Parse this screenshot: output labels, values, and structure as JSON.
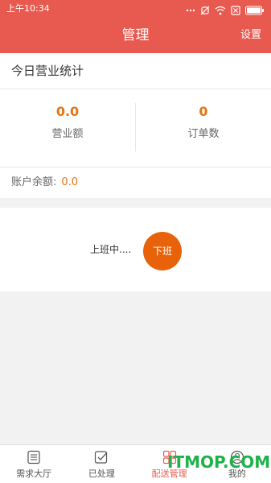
{
  "status": {
    "time": "上午10:34"
  },
  "header": {
    "title": "管理",
    "settings": "设置"
  },
  "stats": {
    "title": "今日营业统计",
    "revenue_value": "0.0",
    "revenue_label": "营业额",
    "orders_value": "0",
    "orders_label": "订单数",
    "balance_label": "账户余额:",
    "balance_value": "0.0"
  },
  "work": {
    "status": "上班中....",
    "button": "下班"
  },
  "tabs": [
    {
      "label": "需求大厅",
      "icon": "list-icon"
    },
    {
      "label": "已处理",
      "icon": "check-box-icon"
    },
    {
      "label": "配送管理",
      "icon": "grid-icon",
      "active": true
    },
    {
      "label": "我的",
      "icon": "user-icon"
    }
  ],
  "watermark": "ITMOP.COM",
  "colors": {
    "accent": "#e85a50",
    "value_orange": "#e8730f",
    "button_orange": "#e8620a",
    "watermark_green": "#1db24a"
  }
}
